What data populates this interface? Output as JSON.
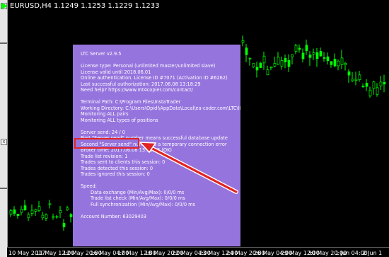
{
  "symbol": {
    "label": "EURUSD,H4",
    "quote": "1.1249 1.1253 1.1229 1.1233"
  },
  "colors": {
    "panel_bg": "#9674de",
    "candle_up": "#00ff00",
    "highlight": "#e12424",
    "arrow": "#e12424"
  },
  "panel": {
    "version": "LTC Server v2.9.5",
    "license_type": "License type: Personal (unlimited master/unlimited slave)",
    "license_valid": "License  valid until 2018.06.01",
    "online_auth": "Online authentication. License ID #7071 (Activation ID #6262)",
    "last_auth": "Last successful authorization: 2017.06.08 13:18:29",
    "help": "Need help? https://www.mt4copier.com/contact/",
    "terminal_path": "Terminal Path: C:\\Program Files\\InstaTrader",
    "working_dir": "Working Directory: C:\\Users\\Opidi\\AppData\\Local\\ea-coder.com\\LTC\\ltctrades\\",
    "monitoring_pairs": "Monitoring ALL pairs",
    "monitoring_positions": "Monitoring ALL types of positions",
    "server_send": "Server send: 24 / 0",
    "first_send": "First \"Server send\" number means successful database update",
    "second_send": "Second \"Server send\" number is a temporary connection error",
    "broker_time": "Broker time: 2017.06.08 13:18:42 (OK)",
    "trade_list_revision": "Trade list revision: 1",
    "trades_sent": "Trades sent to clients this session: 0",
    "trades_detected": "Trades detected this session: 0",
    "trades_ignored": "Trades ignored this session: 0",
    "speed_heading": "Speed:",
    "speed_data_exchange": "Data exchange (Min/Avg/Max): 0/0/0 ms",
    "speed_trade_list": "Trade list check (Min/Avg/Max): 0/0/0 ms",
    "speed_full_sync": "Full synchronization (Min/Avg/Max): 0/0/0 ms",
    "account_number": "Account Number: 63029403"
  },
  "time_axis": [
    "10 May 2017",
    "11 May 12:00",
    "12 May 20:00",
    "16 May 04:00",
    "17 May 12:00",
    "18 May 20:00",
    "22 May 04:00",
    "23 May 12:00",
    "24 May 20:00",
    "26 May 04:00",
    "29 May 12:00",
    "30 May 20:00",
    "1 Jun 04:00",
    "2 Jun 1"
  ],
  "left_strip": {
    "btn_top": "x",
    "btn_mid": "x"
  }
}
